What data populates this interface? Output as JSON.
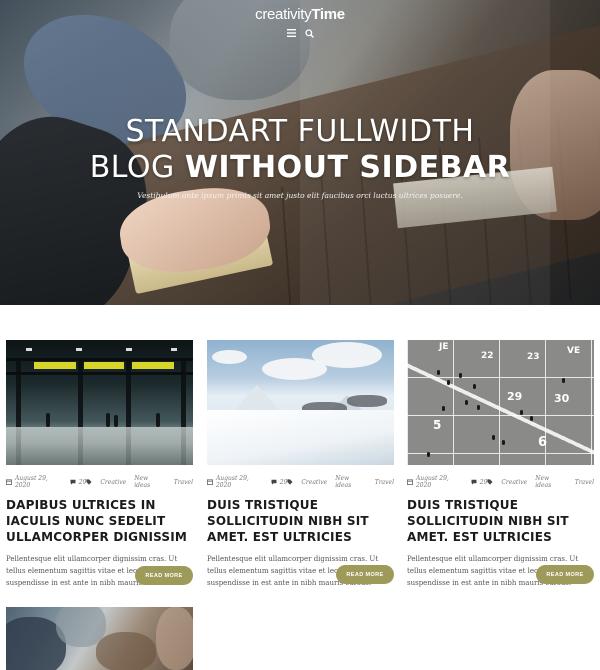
{
  "header": {
    "brand_light": "creativity",
    "brand_bold": "Time",
    "menu_icon": "menu-icon",
    "search_icon": "search-icon"
  },
  "hero": {
    "title_line1": "STANDART FULLWIDTH",
    "title_line2_light": "BLOG ",
    "title_line2_bold": "WITHOUT SIDEBAR",
    "subtitle": "Vestibulum ante ipsum primis sit amet justo elit faucibus orci luctus ultrices posuere."
  },
  "posts": [
    {
      "date": "August 29, 2020",
      "comments": "29",
      "tags": [
        "Creative",
        "New ideas",
        "Travel"
      ],
      "title": "DAPIBUS ULTRICES IN IACULIS NUNC SEDELIT ULLAMCORPER DIGNISSIM",
      "excerpt": "Pellentesque elit ullamcorper dignissim cras. Ut tellus elementum sagittis vitae et leo. Dignissim suspendisse in est ante in nibh mauris cursus.",
      "button": "READ MORE",
      "image": "subway-station-photo"
    },
    {
      "date": "August 29, 2020",
      "comments": "29",
      "tags": [
        "Creative",
        "New ideas",
        "Travel"
      ],
      "title": "DUIS TRISTIQUE SOLLICITUDIN NIBH SIT AMET. EST ULTRICIES",
      "excerpt": "Pellentesque elit ullamcorper dignissim cras. Ut tellus elementum sagittis vitae et leo. Dignissim suspendisse in est ante in nibh mauris cursus.",
      "button": "READ MORE",
      "image": "snowy-mountains-photo"
    },
    {
      "date": "August 29, 2020",
      "comments": "29",
      "tags": [
        "Creative",
        "New ideas",
        "Travel"
      ],
      "title": "DUIS TRISTIQUE SOLLICITUDIN NIBH SIT AMET. EST ULTRICIES",
      "excerpt": "Pellentesque elit ullamcorper dignissim cras. Ut tellus elementum sagittis vitae et leo. Dignissim suspendisse in est ante in nibh mauris cursus.",
      "button": "READ MORE",
      "image": "calendar-plaza-photo",
      "grid_numbers": [
        "JE",
        "VE",
        "22",
        "23",
        "29",
        "30",
        "5",
        "6"
      ]
    },
    {
      "image": "meeting-photo"
    }
  ],
  "colors": {
    "accent_button": "#9e9a59",
    "title_text": "#1b1b1b",
    "body_text": "#555555",
    "meta_text": "#777777"
  }
}
